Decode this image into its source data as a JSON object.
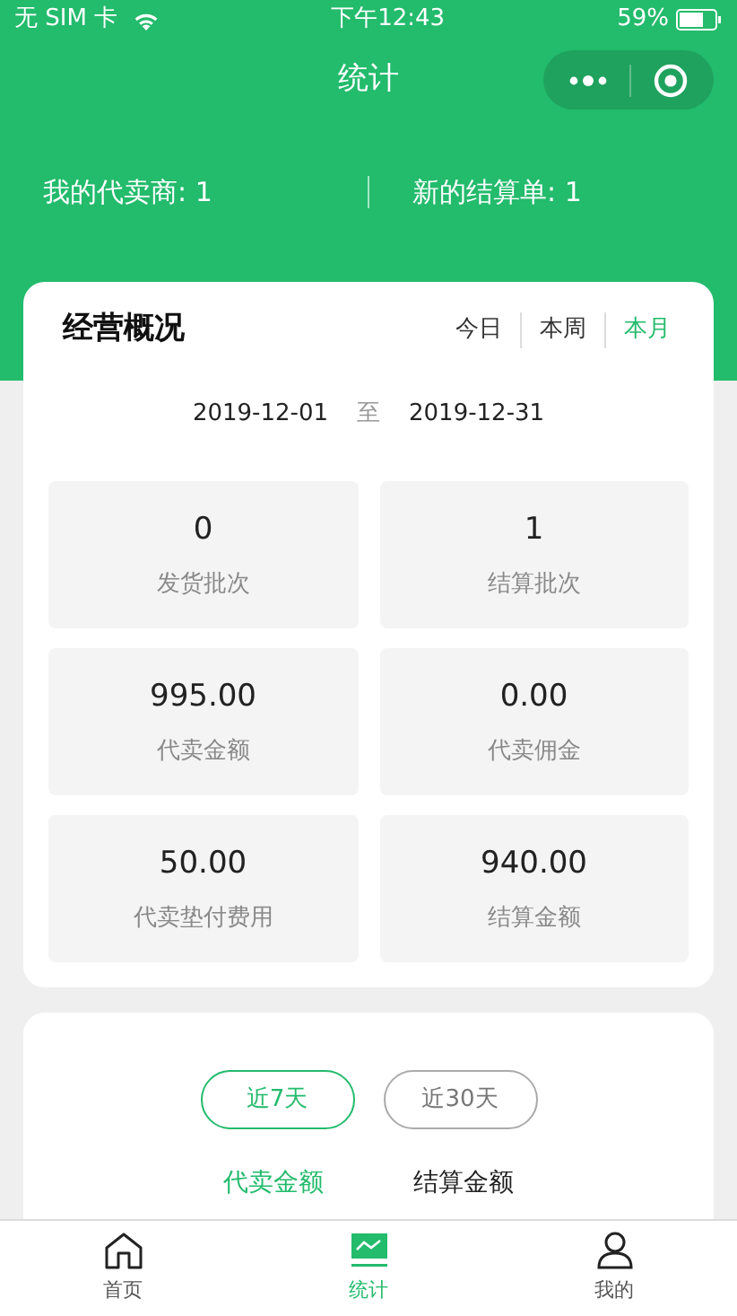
{
  "status_bar": {
    "carrier": "无 SIM 卡",
    "time": "下午12:43",
    "battery": "59%"
  },
  "nav_bar": {
    "title": "统计"
  },
  "summary": [
    {
      "label": "我的代卖商: 1"
    },
    {
      "label": "新的结算单: 1"
    }
  ],
  "overview": {
    "title": "经营概况",
    "periods": [
      {
        "label": "今日",
        "selected": false
      },
      {
        "label": "本周",
        "selected": false
      },
      {
        "label": "本月",
        "selected": true
      }
    ],
    "date_from": "2019-12-01",
    "date_sep": "至",
    "date_to": "2019-12-31",
    "stats": [
      {
        "value": "0",
        "label": "发货批次"
      },
      {
        "value": "1",
        "label": "结算批次"
      },
      {
        "value": "995.00",
        "label": "代卖金额"
      },
      {
        "value": "0.00",
        "label": "代卖佣金"
      },
      {
        "value": "50.00",
        "label": "代卖垫付费用"
      },
      {
        "value": "940.00",
        "label": "结算金额"
      }
    ]
  },
  "trend": {
    "ranges": [
      {
        "label": "近7天",
        "selected": true
      },
      {
        "label": "近30天",
        "selected": false
      }
    ],
    "metrics": [
      {
        "label": "代卖金额",
        "selected": true
      },
      {
        "label": "结算金额",
        "selected": false
      }
    ]
  },
  "tab_bar": [
    {
      "label": "首页",
      "kind": "home",
      "selected": false
    },
    {
      "label": "统计",
      "kind": "chart",
      "selected": true
    },
    {
      "label": "我的",
      "kind": "user",
      "selected": false
    }
  ]
}
